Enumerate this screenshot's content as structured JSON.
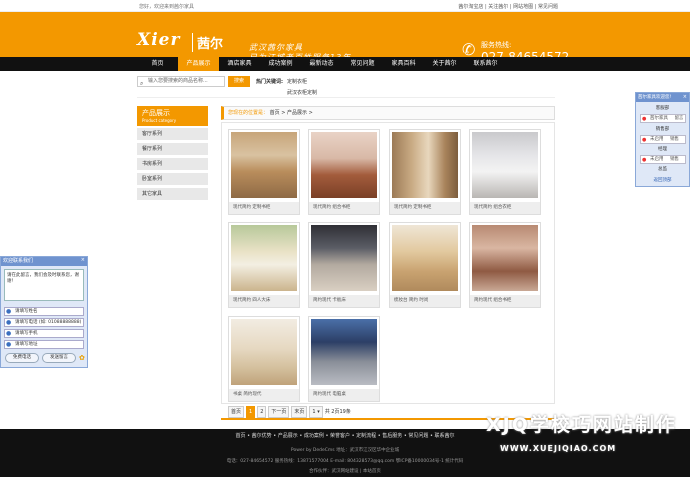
{
  "topbar": {
    "welcome": "您好，欢迎来到茜尔家具",
    "links": "茜尔淘宝店 | 关注茜尔 | 网站地图 | 常见问题"
  },
  "header": {
    "logo_en": "Xier",
    "logo_cn": "茜尔",
    "slogan_line1": "武汉茜尔家具",
    "slogan_line2": "已为江城老百姓服务13年",
    "hotline_label": "服务热线:",
    "hotline_number": "027-84654572",
    "brand_color": "#f39800"
  },
  "nav": {
    "items": [
      "首页",
      "产品展示",
      "酒店家具",
      "成功案例",
      "最新动态",
      "常见问题",
      "家具百科",
      "关于茜尔",
      "联系茜尔"
    ],
    "active_index": 1
  },
  "search": {
    "placeholder": "输入您要搜索的商品名称...",
    "button": "搜索",
    "keywords_label": "热门关键词:",
    "keyword1": "定制衣柜",
    "keyword2": "武汉衣柜定制"
  },
  "sidebar": {
    "title_cn": "产品展示",
    "title_en": "Product category",
    "items": [
      "客厅系列",
      "餐厅系列",
      "书房系列",
      "卧室系列",
      "其它家具"
    ]
  },
  "breadcrumb": {
    "label": "您现在的位置是：",
    "home": "首页",
    "current": "产品展示"
  },
  "products": [
    {
      "caption": "现代简约 定制书柜"
    },
    {
      "caption": "现代简约 组合书柜"
    },
    {
      "caption": "现代简约 定制书柜"
    },
    {
      "caption": "现代简约 组合衣柜"
    },
    {
      "caption": "现代简约 四人大床"
    },
    {
      "caption": "简约现代 卡板床"
    },
    {
      "caption": "梳妆台 简约 时尚"
    },
    {
      "caption": "简约现代 组合书柜"
    },
    {
      "caption": "书桌 简约现代"
    },
    {
      "caption": "简约现代 电脑桌"
    }
  ],
  "pager": {
    "first": "首页",
    "p1": "1",
    "p2": "2",
    "next": "下一页",
    "last": "末页",
    "select": "1",
    "summary": "共 2页19条"
  },
  "footer": {
    "nav": "首页 • 茜尔优势 • 产品展示 • 成功案例 • 荣誉客户 • 定制流程 • 售后服务 • 常见问题 • 联系茜尔",
    "powered": "Power by DedeCms  地址：武汉市江汉区华中企业城",
    "contact": "电话：027-84654572  服务热线：13871577004  E-mail: 804328573@qq.com  鄂ICP备10000034号-1  统计代码",
    "partner": "合作伙伴：武汉网站建设 | 本站首页"
  },
  "watermark": {
    "line1": "XJQ学校巧网站制作",
    "line2": "WWW.XUEJIQIAO.COM"
  },
  "chat": {
    "title": "欢迎联系我们",
    "close": "×",
    "message": "请在此留言，我们会及时联系您，谢谢！",
    "name_placeholder": "请填写姓名",
    "phone_placeholder": "请填写电话 (如: 01088888888)",
    "mobile_placeholder": "请填写手机",
    "address_placeholder": "请填写地址",
    "free_call": "免费电话",
    "send": "发送留言"
  },
  "kefu": {
    "title": "茜尔家具欢迎您!",
    "close": "×",
    "group1": "客服部",
    "a": "茜尔家具",
    "b": "留言",
    "group2": "销售部",
    "c": "未启用",
    "d": "销售",
    "group3": "经理",
    "e": "未启用",
    "f": "销售",
    "g": "总监",
    "back": "返回顶部"
  }
}
